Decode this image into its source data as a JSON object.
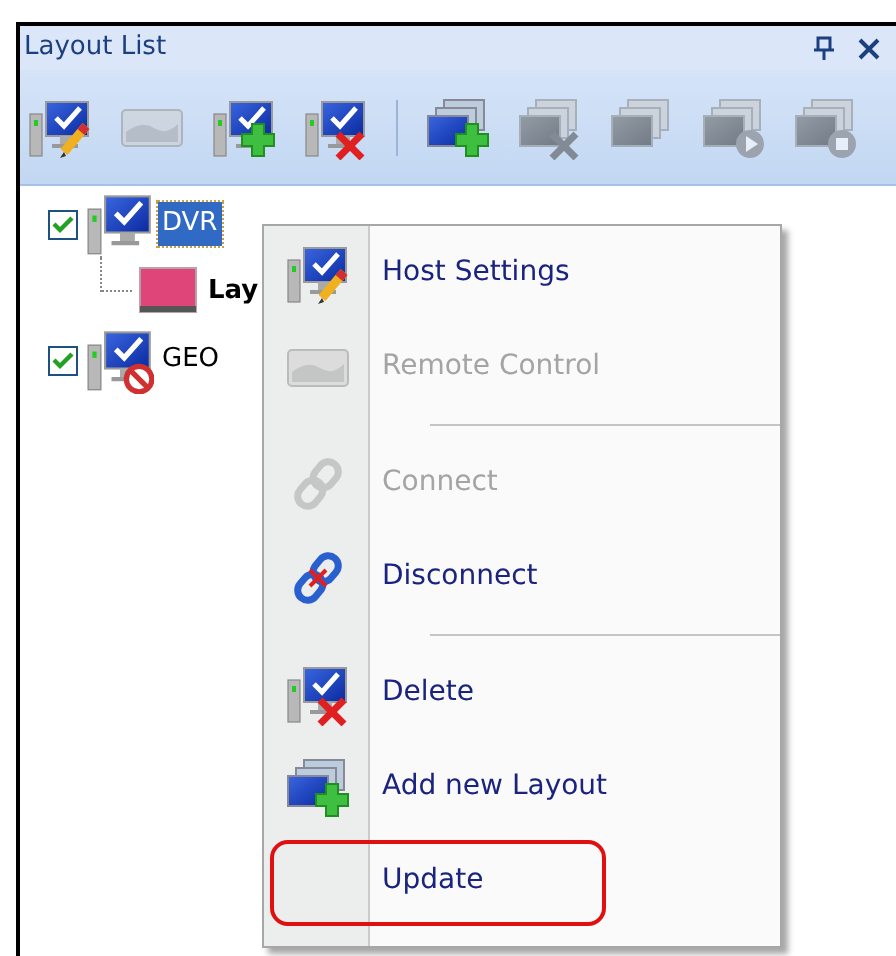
{
  "panel": {
    "title": "Layout List"
  },
  "toolbar": [
    {
      "disabled": false
    },
    {
      "disabled": true
    },
    {
      "disabled": false
    },
    {
      "disabled": false
    },
    {
      "kind": "separator"
    },
    {
      "disabled": false
    },
    {
      "disabled": true
    },
    {
      "disabled": true
    },
    {
      "disabled": true
    },
    {
      "disabled": true
    }
  ],
  "tree": [
    {
      "label": "DVR",
      "checked": true,
      "selected": true,
      "children": [
        {
          "label": "Lay",
          "selected": false
        }
      ]
    },
    {
      "label": "GEO",
      "checked": true,
      "selected": false
    }
  ],
  "context_menu": {
    "items": [
      {
        "kind": "item",
        "label": "Host Settings",
        "disabled": false,
        "highlighted": false
      },
      {
        "kind": "item",
        "label": "Remote Control",
        "disabled": true,
        "highlighted": false
      },
      {
        "kind": "separator"
      },
      {
        "kind": "item",
        "label": "Connect",
        "disabled": true,
        "highlighted": false
      },
      {
        "kind": "item",
        "label": "Disconnect",
        "disabled": false,
        "highlighted": false
      },
      {
        "kind": "separator"
      },
      {
        "kind": "item",
        "label": "Delete",
        "disabled": false,
        "highlighted": false
      },
      {
        "kind": "item",
        "label": "Add new Layout",
        "disabled": false,
        "highlighted": false
      },
      {
        "kind": "item",
        "label": "Update",
        "disabled": false,
        "highlighted": true
      }
    ]
  }
}
